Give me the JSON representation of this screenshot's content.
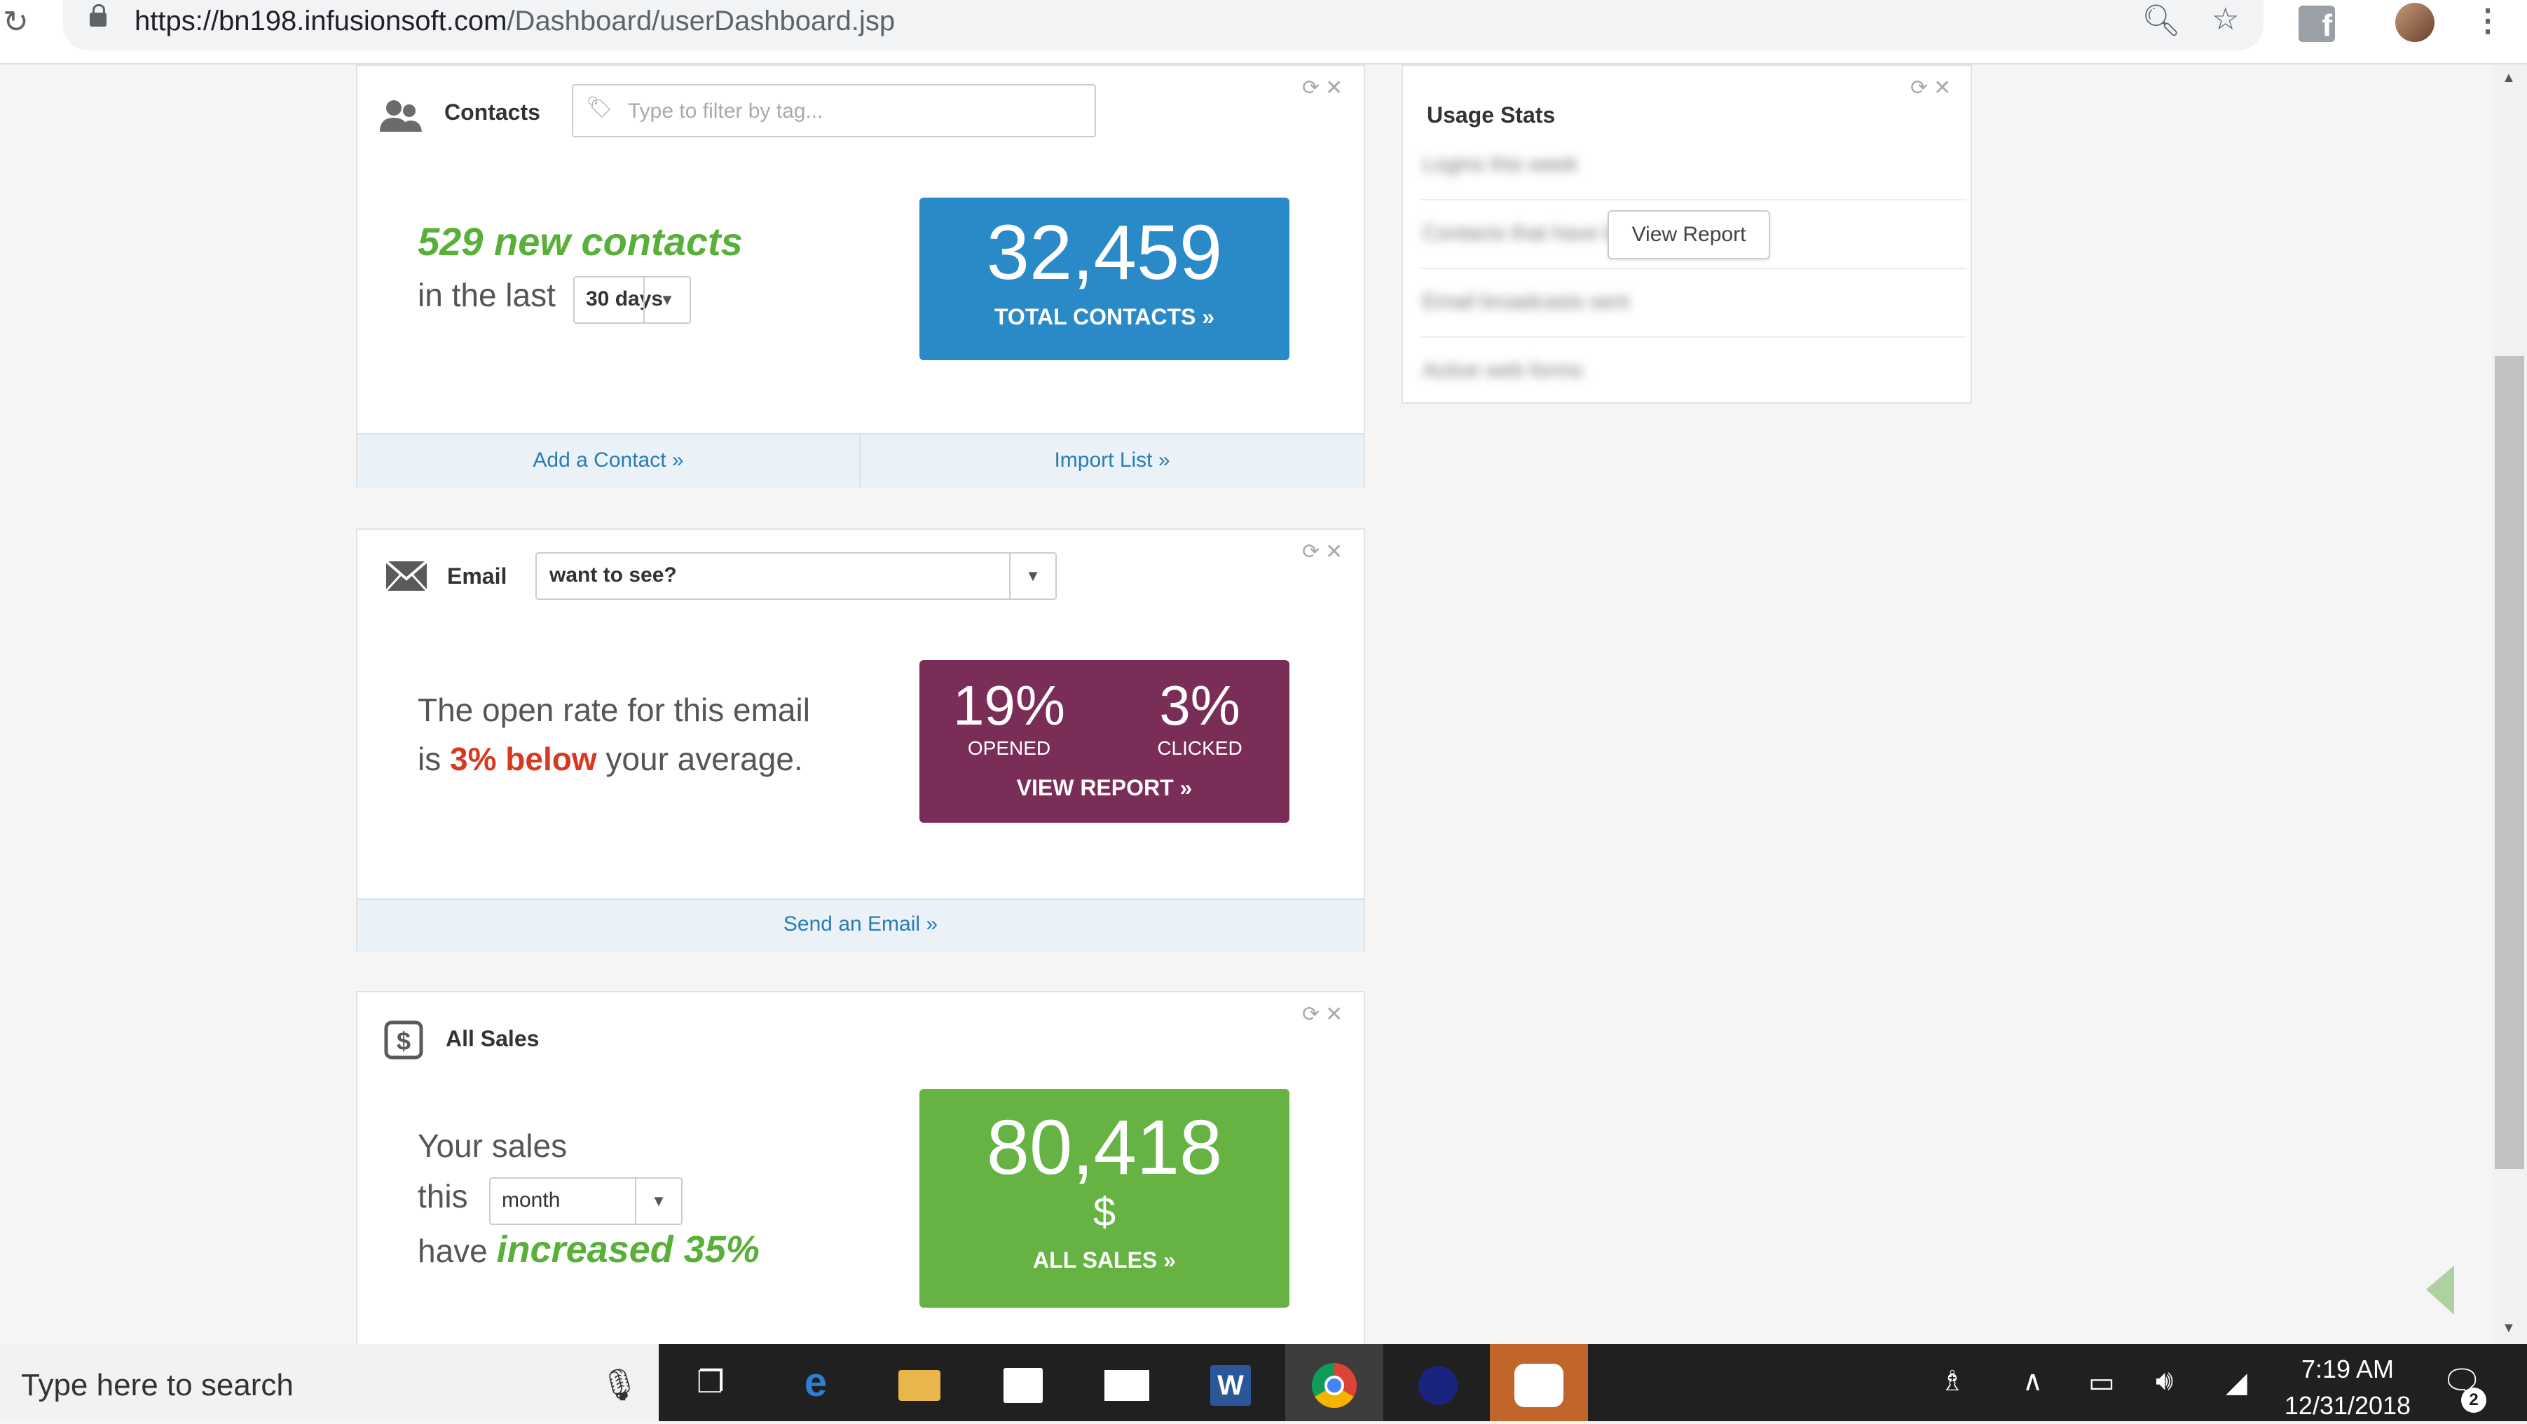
{
  "browser": {
    "url_scheme_host": "https://bn198.infusionsoft.com",
    "url_path": "/Dashboard/userDashboard.jsp",
    "icons": [
      "reload-icon",
      "lock-icon",
      "zoom-icon",
      "star-icon",
      "facebook-icon",
      "avatar",
      "kebab-menu-icon"
    ]
  },
  "contacts": {
    "title": "Contacts",
    "filter_placeholder": "Type to filter by tag...",
    "new_count_text": "529 new contacts",
    "in_the_last": "in the last",
    "range_value": "30 days",
    "total_value": "32,459",
    "total_label": "TOTAL CONTACTS »",
    "add_contact": "Add a Contact »",
    "import_list": "Import List »"
  },
  "email": {
    "title": "Email",
    "select_value": "want to see?",
    "open_rate_line1": "The open rate for this email",
    "open_rate_is": "is",
    "open_rate_delta": "3% below",
    "open_rate_tail": "your average.",
    "opened_value": "19%",
    "opened_label": "OPENED",
    "clicked_value": "3%",
    "clicked_label": "CLICKED",
    "view_report": "VIEW REPORT »",
    "send_email": "Send an Email »"
  },
  "sales": {
    "title": "All Sales",
    "line1": "Your sales",
    "this": "this",
    "period_value": "month",
    "have": "have",
    "change": "increased 35%",
    "total_value": "80,418",
    "currency": "$",
    "total_label": "ALL SALES »"
  },
  "usage": {
    "title": "Usage Stats",
    "rows": [
      "Logins this week",
      "Contacts that have been added",
      "Email broadcasts sent",
      "Active web forms"
    ],
    "view_report_button": "View Report"
  },
  "taskbar": {
    "search_placeholder": "Type here to search",
    "time": "7:19 AM",
    "date": "12/31/2018",
    "notification_count": "2"
  },
  "colors": {
    "contacts_blue": "#2a8ac8",
    "email_maroon": "#7a2d57",
    "sales_green": "#66b243",
    "green_text": "#59b039",
    "red_text": "#d9381e"
  }
}
